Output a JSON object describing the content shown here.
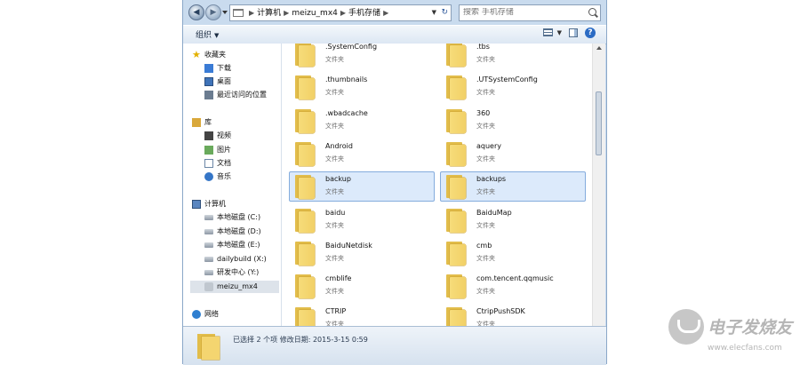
{
  "address": {
    "crumbs": [
      "计算机",
      "meizu_mx4",
      "手机存储"
    ]
  },
  "search": {
    "placeholder": "搜索 手机存储"
  },
  "toolbar": {
    "organize_label": "组织"
  },
  "nav": {
    "favorites": {
      "label": "收藏夹",
      "items": [
        "下载",
        "桌面",
        "最近访问的位置"
      ]
    },
    "libraries": {
      "label": "库",
      "items": [
        "视频",
        "图片",
        "文档",
        "音乐"
      ]
    },
    "computer": {
      "label": "计算机",
      "items": [
        "本地磁盘 (C:)",
        "本地磁盘 (D:)",
        "本地磁盘 (E:)",
        "dailybuild (X:)",
        "研发中心 (Y:)",
        "meizu_mx4"
      ]
    },
    "network": {
      "label": "网络"
    }
  },
  "folders": [
    {
      "name": ".SystemConfig",
      "type": "文件夹",
      "selected": false
    },
    {
      "name": ".tbs",
      "type": "文件夹",
      "selected": false
    },
    {
      "name": ".thumbnails",
      "type": "文件夹",
      "selected": false
    },
    {
      "name": ".UTSystemConfig",
      "type": "文件夹",
      "selected": false
    },
    {
      "name": ".wbadcache",
      "type": "文件夹",
      "selected": false
    },
    {
      "name": "360",
      "type": "文件夹",
      "selected": false
    },
    {
      "name": "Android",
      "type": "文件夹",
      "selected": false
    },
    {
      "name": "aquery",
      "type": "文件夹",
      "selected": false
    },
    {
      "name": "backup",
      "type": "文件夹",
      "selected": true
    },
    {
      "name": "backups",
      "type": "文件夹",
      "selected": true
    },
    {
      "name": "baidu",
      "type": "文件夹",
      "selected": false
    },
    {
      "name": "BaiduMap",
      "type": "文件夹",
      "selected": false
    },
    {
      "name": "BaiduNetdisk",
      "type": "文件夹",
      "selected": false
    },
    {
      "name": "cmb",
      "type": "文件夹",
      "selected": false
    },
    {
      "name": "cmblife",
      "type": "文件夹",
      "selected": false
    },
    {
      "name": "com.tencent.qqmusic",
      "type": "文件夹",
      "selected": false
    },
    {
      "name": "CTRIP",
      "type": "文件夹",
      "selected": false
    },
    {
      "name": "CtripPushSDK",
      "type": "文件夹",
      "selected": false
    }
  ],
  "status": {
    "text": "已选择 2 个项  修改日期: 2015-3-15 0:59"
  },
  "watermark": {
    "brand": "电子发烧友",
    "url": "www.elecfans.com"
  }
}
